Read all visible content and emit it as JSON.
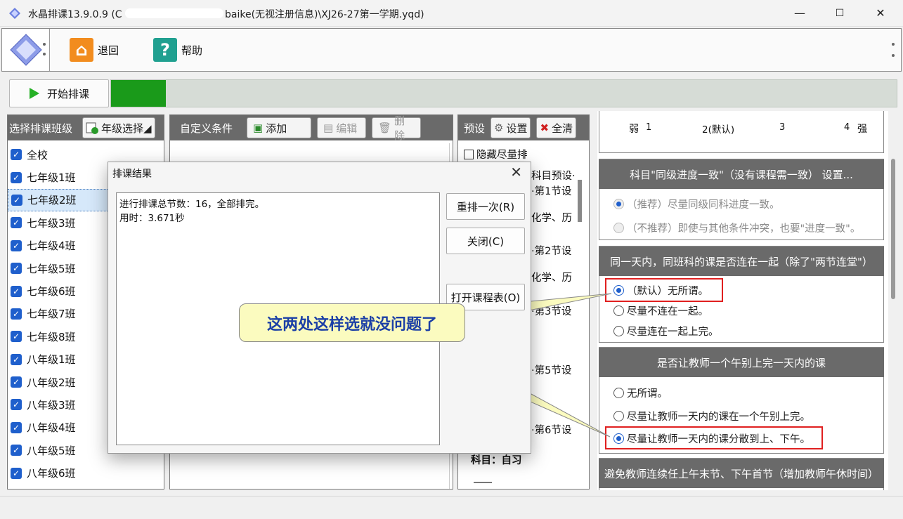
{
  "window": {
    "title": "水晶排课13.9.0.9    (C",
    "title_tail": "baike(无视注册信息)\\XJ26-27第一学期.yqd)",
    "min": "—",
    "max": "☐",
    "close": "✕"
  },
  "toolbar": {
    "back_label": "退回",
    "help_label": "帮助",
    "help_glyph": "?"
  },
  "run": {
    "start_label": "开始排课",
    "progress_pct": 7
  },
  "left_panel": {
    "header": "选择排课班级",
    "grade_button": "年级选择◢",
    "items": [
      {
        "label": "全校"
      },
      {
        "label": "七年级1班"
      },
      {
        "label": "七年级2班",
        "selected": true
      },
      {
        "label": "七年级3班"
      },
      {
        "label": "七年级4班"
      },
      {
        "label": "七年级5班"
      },
      {
        "label": "七年级6班"
      },
      {
        "label": "七年级7班"
      },
      {
        "label": "七年级8班"
      },
      {
        "label": "八年级1班"
      },
      {
        "label": "八年级2班"
      },
      {
        "label": "八年级3班"
      },
      {
        "label": "八年级4班"
      },
      {
        "label": "八年级5班"
      },
      {
        "label": "八年级6班"
      }
    ]
  },
  "custom_panel": {
    "header": "自定义条件",
    "add_label": "添加",
    "edit_label": "编辑",
    "delete_label": "删除"
  },
  "preset_panel": {
    "header": "预设",
    "settings_label": "设置",
    "clear_label": "全清",
    "hide_label": "隐藏尽量排",
    "lines": [
      "科目预设·",
      "·第1节设",
      "化学、历",
      "·第2节设",
      "化学、历",
      "·第3节设",
      "·第5节设",
      "·第6节设",
      "科目：自习"
    ]
  },
  "right_panel": {
    "strength": {
      "weak": "弱",
      "s1": "1",
      "s2": "2(默认)",
      "s3": "3",
      "s4": "4",
      "strong": "强"
    },
    "sec1": {
      "title": "科目\"同级进度一致\"（没有课程需一致） 设置...",
      "opt1": "（推荐）尽量同级同科进度一致。",
      "opt2": "（不推荐）即使与其他条件冲突，也要\"进度一致\"。"
    },
    "sec2": {
      "title": "同一天内，同班科的课是否连在一起（除了\"两节连堂\"）",
      "opt1": "（默认）无所谓。",
      "opt2": "尽量不连在一起。",
      "opt3": "尽量连在一起上完。"
    },
    "sec3": {
      "title": "是否让教师一个午别上完一天内的课",
      "opt1": "无所谓。",
      "opt2": "尽量让教师一天内的课在一个午别上完。",
      "opt3": "尽量让教师一天内的课分散到上、下午。"
    },
    "sec4": {
      "title": "避免教师连续任上午末节、下午首节（增加教师午休时间）"
    }
  },
  "dialog": {
    "title": "排课结果",
    "close": "✕",
    "line1": "进行排课总节数：16，全部排完。",
    "line2": "用时：3.671秒",
    "rerun_label": "重排一次(R)",
    "close_label": "关闭(C)",
    "open_label": "打开课程表(O)"
  },
  "callout": {
    "text": "这两处这样选就没问题了"
  },
  "colors": {
    "progress": "#1a9a1a",
    "header": "#6a6a6a",
    "accent": "#1f5fcc",
    "highlight": "#e02020",
    "callout": "#fbfbbf"
  }
}
